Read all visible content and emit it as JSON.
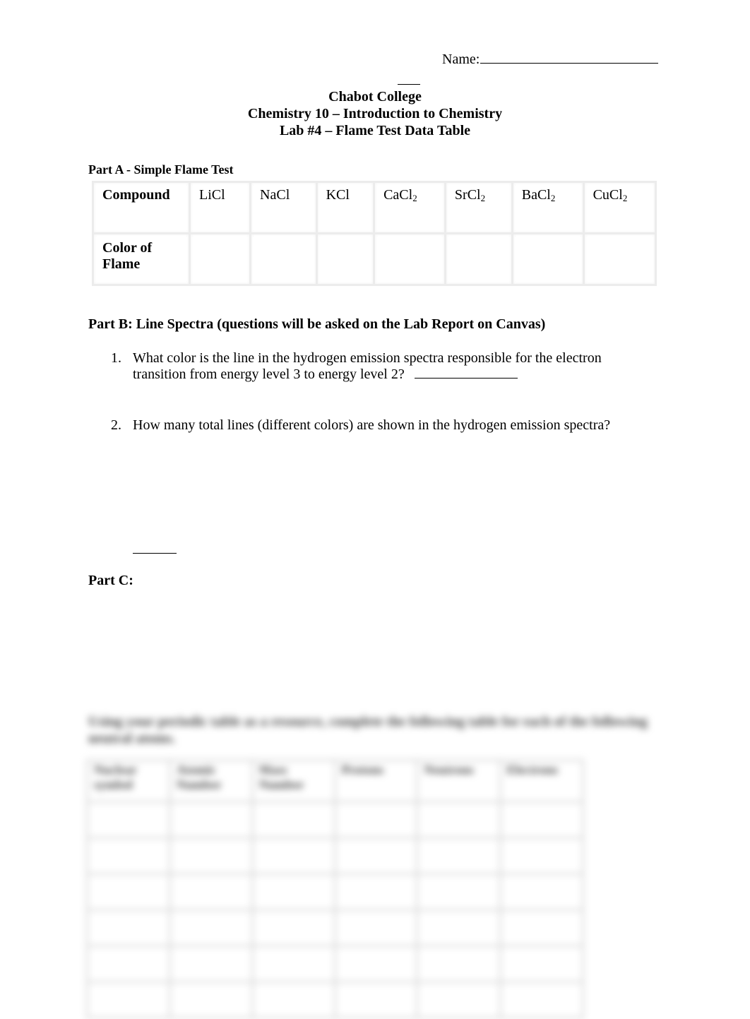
{
  "header": {
    "name_label": "Name:",
    "college": "Chabot College",
    "course": "Chemistry 10 – Introduction to Chemistry",
    "lab_title": "Lab #4 – Flame Test Data Table"
  },
  "part_a": {
    "title": "Part A - Simple Flame Test",
    "row_headers": [
      "Compound",
      "Color of Flame"
    ],
    "compounds": [
      {
        "base": "LiCl",
        "sub": ""
      },
      {
        "base": "NaCl",
        "sub": ""
      },
      {
        "base": "KCl",
        "sub": ""
      },
      {
        "base": "CaCl",
        "sub": "2"
      },
      {
        "base": "SrCl",
        "sub": "2"
      },
      {
        "base": "BaCl",
        "sub": "2"
      },
      {
        "base": "CuCl",
        "sub": "2"
      }
    ],
    "flame_colors": [
      "",
      "",
      "",
      "",
      "",
      "",
      ""
    ]
  },
  "part_b": {
    "title": "Part B:  Line Spectra (questions will be asked on the Lab Report on Canvas)",
    "questions": [
      {
        "number": "1.",
        "text": " What color is the line in the hydrogen emission spectra responsible for the electron transition from energy level 3 to energy level 2?",
        "answer": ""
      },
      {
        "number": "2.",
        "text": "How many total lines (different colors) are shown in the hydrogen emission spectra?",
        "answer": ""
      }
    ]
  },
  "part_c": {
    "title": "Part C:",
    "blurred_instructions": "Using your periodic table as a resource, complete the following table for each of the following neutral atoms.",
    "blurred_table_headers": [
      "Nuclear symbol",
      "Atomic Number",
      "Mass Number",
      "Protons",
      "Neutrons",
      "Electrons"
    ]
  }
}
